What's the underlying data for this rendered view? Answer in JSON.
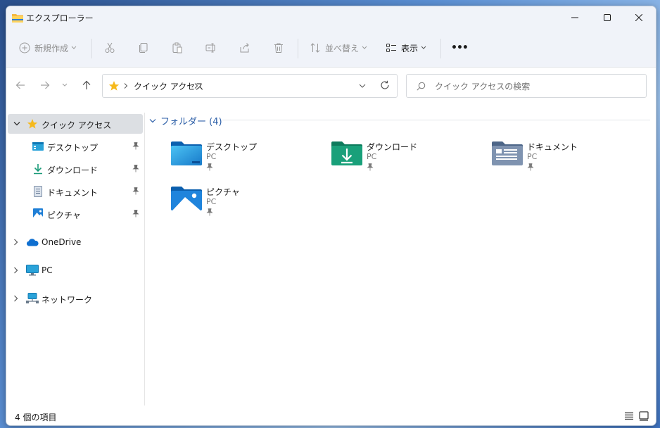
{
  "window": {
    "title": "エクスプローラー"
  },
  "toolbar": {
    "new_label": "新規作成",
    "sort_label": "並べ替え",
    "view_label": "表示",
    "more_label": "•••"
  },
  "address": {
    "location": "クイック アクセス"
  },
  "search": {
    "placeholder": "クイック アクセスの検索"
  },
  "sidebar": {
    "quick_access": "クイック アクセス",
    "pinned": [
      {
        "label": "デスクトップ",
        "icon": "desktop-icon"
      },
      {
        "label": "ダウンロード",
        "icon": "download-icon"
      },
      {
        "label": "ドキュメント",
        "icon": "document-icon"
      },
      {
        "label": "ピクチャ",
        "icon": "pictures-icon"
      }
    ],
    "roots": [
      {
        "label": "OneDrive",
        "icon": "onedrive-icon"
      },
      {
        "label": "PC",
        "icon": "pc-icon"
      },
      {
        "label": "ネットワーク",
        "icon": "network-icon"
      }
    ]
  },
  "content": {
    "group_title": "フォルダー (4)",
    "folders": [
      {
        "name": "デスクトップ",
        "location": "PC",
        "icon": "desktop-folder-icon"
      },
      {
        "name": "ダウンロード",
        "location": "PC",
        "icon": "download-folder-icon"
      },
      {
        "name": "ドキュメント",
        "location": "PC",
        "icon": "document-folder-icon"
      },
      {
        "name": "ピクチャ",
        "location": "PC",
        "icon": "pictures-folder-icon"
      }
    ]
  },
  "status": {
    "item_count": "4 個の項目"
  },
  "colors": {
    "accent": "#0067c0",
    "selected_bg": "#dcdfe3",
    "chrome_bg": "#f0f3f9"
  }
}
